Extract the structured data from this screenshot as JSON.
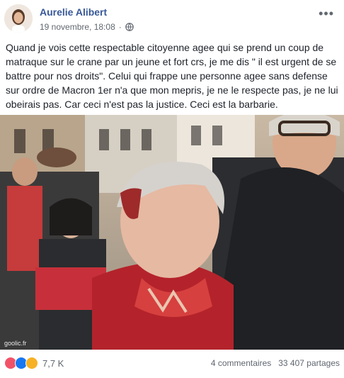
{
  "post": {
    "author": "Aurelie Alibert",
    "date": "19 novembre, 18:08",
    "separator": "·",
    "more_icon": "more-options-icon",
    "privacy_icon": "globe-icon",
    "text": "Quand je vois cette respectable citoyenne agee qui se prend un coup de matraque sur le crane par un jeune et fort crs, je me dis \" il est urgent de se battre pour nos droits\". Celui qui frappe une personne agee sans defense sur ordre de Macron 1er n'a que mon mepris, je ne le respecte pas, je ne lui obeirais pas. Car ceci n'est pas la justice. Ceci est la barbarie.",
    "photo_watermark": "goolic.fr"
  },
  "footer": {
    "reactions": [
      {
        "icon": "angry-reaction-icon",
        "color": "#f25268"
      },
      {
        "icon": "like-reaction-icon",
        "color": "#1877f2"
      },
      {
        "icon": "sad-reaction-icon",
        "color": "#f7b125"
      }
    ],
    "reaction_count": "7,7 K",
    "comments": "4 commentaires",
    "shares": "33 407 partages"
  }
}
